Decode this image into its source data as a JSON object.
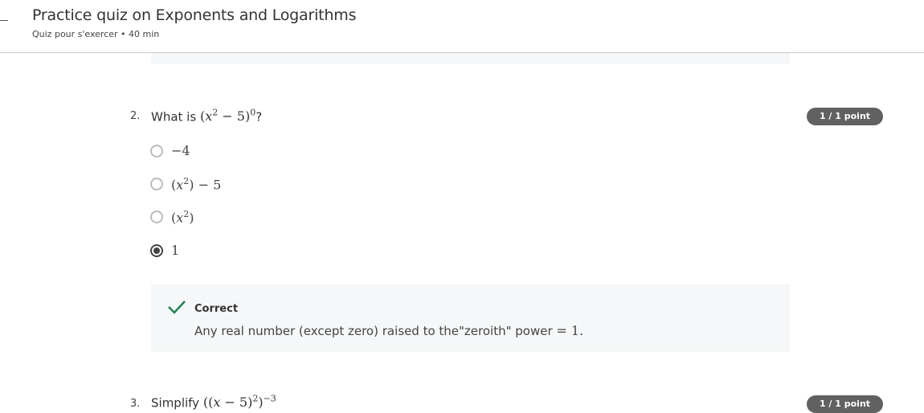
{
  "header": {
    "title": "Practice quiz on Exponents and Logarithms",
    "subtitle": "Quiz pour s'exercer • 40 min"
  },
  "q2": {
    "number": "2.",
    "prefix": "What is ",
    "m1": "(",
    "var": "x",
    "sup1": "2",
    "m2": " − 5)",
    "sup2": "0",
    "suffix": "?",
    "badge": "1 / 1 point",
    "options": [
      {
        "label": "−4",
        "selected": false
      },
      {
        "label": "(x²) − 5",
        "p1": "(",
        "v": "x",
        "s": "2",
        "p2": ") − 5",
        "selected": false
      },
      {
        "label": "(x²)",
        "p1": "(",
        "v": "x",
        "s": "2",
        "p2": ")",
        "selected": false
      },
      {
        "label": "1",
        "selected": true
      }
    ],
    "feedback": {
      "status": "Correct",
      "text": "Any real number (except zero) raised to the\"zeroith\" power ",
      "math": "= 1."
    }
  },
  "q3": {
    "number": "3.",
    "prefix": "Simplify ",
    "m1": "((",
    "var": "x",
    "m2": " − 5)",
    "sup1": "2",
    "m3": ")",
    "sup2": "−3",
    "badge": "1 / 1 point"
  },
  "colors": {
    "correct": "#1f8354",
    "badge": "#616161"
  }
}
